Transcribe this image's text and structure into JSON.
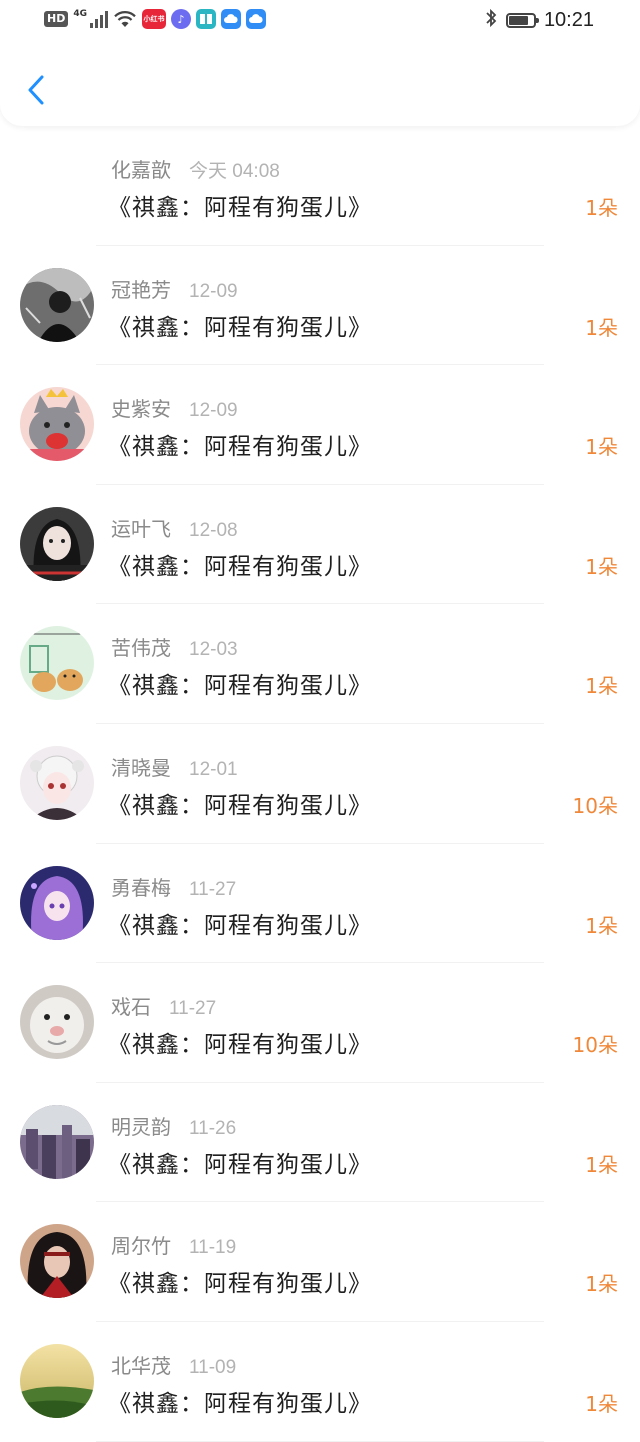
{
  "status_bar": {
    "hd": "HD",
    "network": "4G",
    "signal_level": 4,
    "app_icons": [
      {
        "name": "xiaohongshu-icon",
        "color": "#e8263a",
        "label": "小红书"
      },
      {
        "name": "music-icon",
        "color": "#6c6cf0",
        "label": "♪"
      },
      {
        "name": "reader-icon",
        "color": "#2bb6c4",
        "label": ""
      },
      {
        "name": "cloud-icon-1",
        "color": "#2f8df5",
        "label": ""
      },
      {
        "name": "cloud-icon-2",
        "color": "#2f8df5",
        "label": ""
      }
    ],
    "battery_level": 0.85,
    "time": "10:21"
  },
  "header": {
    "back_icon": "chevron-left-icon",
    "accent_color": "#1e90ff"
  },
  "list": [
    {
      "name": "化嘉歆",
      "date": "今天 04:08",
      "title": "《祺鑫：阿程有狗蛋儿》",
      "count": "1朵",
      "has_avatar": false
    },
    {
      "name": "冠艳芳",
      "date": "12-09",
      "title": "《祺鑫：阿程有狗蛋儿》",
      "count": "1朵",
      "has_avatar": true
    },
    {
      "name": "史紫安",
      "date": "12-09",
      "title": "《祺鑫：阿程有狗蛋儿》",
      "count": "1朵",
      "has_avatar": true
    },
    {
      "name": "运叶飞",
      "date": "12-08",
      "title": "《祺鑫：阿程有狗蛋儿》",
      "count": "1朵",
      "has_avatar": true
    },
    {
      "name": "苦伟茂",
      "date": "12-03",
      "title": "《祺鑫：阿程有狗蛋儿》",
      "count": "1朵",
      "has_avatar": true
    },
    {
      "name": "清晓曼",
      "date": "12-01",
      "title": "《祺鑫：阿程有狗蛋儿》",
      "count": "10朵",
      "has_avatar": true
    },
    {
      "name": "勇春梅",
      "date": "11-27",
      "title": "《祺鑫：阿程有狗蛋儿》",
      "count": "1朵",
      "has_avatar": true
    },
    {
      "name": "戏石",
      "date": "11-27",
      "title": "《祺鑫：阿程有狗蛋儿》",
      "count": "10朵",
      "has_avatar": true
    },
    {
      "name": "明灵韵",
      "date": "11-26",
      "title": "《祺鑫：阿程有狗蛋儿》",
      "count": "1朵",
      "has_avatar": true
    },
    {
      "name": "周尔竹",
      "date": "11-19",
      "title": "《祺鑫：阿程有狗蛋儿》",
      "count": "1朵",
      "has_avatar": true
    },
    {
      "name": "北华茂",
      "date": "11-09",
      "title": "《祺鑫：阿程有狗蛋儿》",
      "count": "1朵",
      "has_avatar": true
    }
  ],
  "colors": {
    "count": "#f0883a",
    "name": "#8a8a8a",
    "date": "#b3b3b3"
  }
}
